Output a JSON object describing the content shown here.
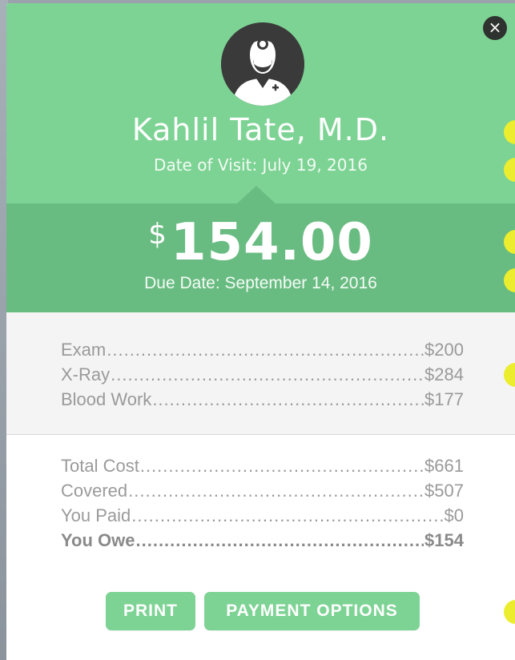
{
  "header": {
    "doctor_name": "Kahlil Tate, M.D.",
    "visit_date": "Date of Visit: July 19, 2016",
    "avatar_icon": "doctor-avatar-icon",
    "close_icon": "close-icon",
    "close_symbol": "×",
    "background_color": "#7dd394"
  },
  "amount": {
    "currency": "$",
    "value": "154.00",
    "due_date": "Due Date: September 14, 2016",
    "band_color": "#69bc81"
  },
  "items": [
    {
      "label": "Exam",
      "value": "$200"
    },
    {
      "label": "X-Ray",
      "value": "$284"
    },
    {
      "label": "Blood Work",
      "value": "$177"
    }
  ],
  "totals": [
    {
      "label": "Total Cost",
      "value": "$661"
    },
    {
      "label": "Covered",
      "value": "$507"
    },
    {
      "label": "You Paid",
      "value": "$0"
    },
    {
      "label": "You Owe",
      "value": "$154"
    }
  ],
  "buttons": {
    "print": "PRINT",
    "payment_options": "PAYMENT OPTIONS"
  },
  "accent_dot_color": "#eced2e"
}
